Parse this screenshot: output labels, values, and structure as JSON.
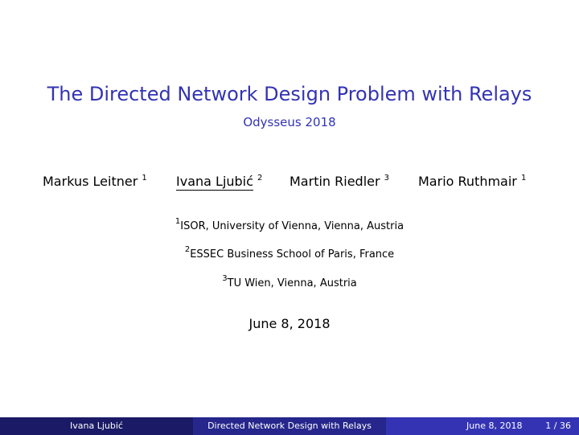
{
  "title": "The Directed Network Design Problem with Relays",
  "subtitle": "Odysseus 2018",
  "authors": [
    {
      "name": "Markus Leitner",
      "sup": "1"
    },
    {
      "name": "Ivana Ljubić",
      "sup": "2"
    },
    {
      "name": "Martin Riedler",
      "sup": "3"
    },
    {
      "name": "Mario Ruthmair",
      "sup": "1"
    }
  ],
  "affiliations": [
    {
      "sup": "1",
      "text": "ISOR, University of Vienna, Vienna, Austria"
    },
    {
      "sup": "2",
      "text": "ESSEC Business School of Paris, France"
    },
    {
      "sup": "3",
      "text": "TU Wien, Vienna, Austria"
    }
  ],
  "date": "June 8, 2018",
  "footer": {
    "author": "Ivana Ljubić",
    "short_title": "Directed Network Design with Relays",
    "date": "June 8, 2018",
    "page": "1 / 36"
  },
  "colors": {
    "title": "#3333b3",
    "footer_dark": "#1a1a66",
    "footer_mid": "#26268c",
    "footer_light": "#3333b3"
  }
}
